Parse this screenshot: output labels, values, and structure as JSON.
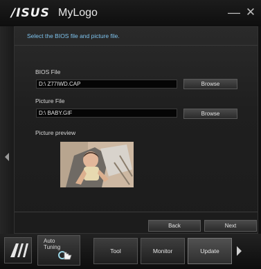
{
  "window": {
    "brand": "/ISUS",
    "title": "MyLogo"
  },
  "instruction": "Select the BIOS file and picture file.",
  "bios": {
    "label": "BIOS File",
    "value": "D:\\ Z77IWD.CAP",
    "browse_label": "Browse"
  },
  "picture": {
    "label": "Picture File",
    "value": "D:\\ BABY.GIF",
    "browse_label": "Browse"
  },
  "preview_label": "Picture preview",
  "nav_buttons": {
    "back_label": "Back",
    "next_label": "Next"
  },
  "bottom_tabs": {
    "auto_tuning_line1": "Auto",
    "auto_tuning_line2": "Tuning",
    "tool_label": "Tool",
    "monitor_label": "Monitor",
    "update_label": "Update",
    "active_tab": "Update"
  },
  "icons": {
    "minimize": "minimize-icon",
    "close": "close-icon",
    "ai_logo": "ai-suite-logo-icon",
    "left_arrow": "left-arrow-icon",
    "right_arrow": "right-arrow-icon",
    "pointer": "hand-pointer-icon"
  },
  "colors": {
    "accent_text": "#7ec3ee",
    "background": "#111111"
  }
}
